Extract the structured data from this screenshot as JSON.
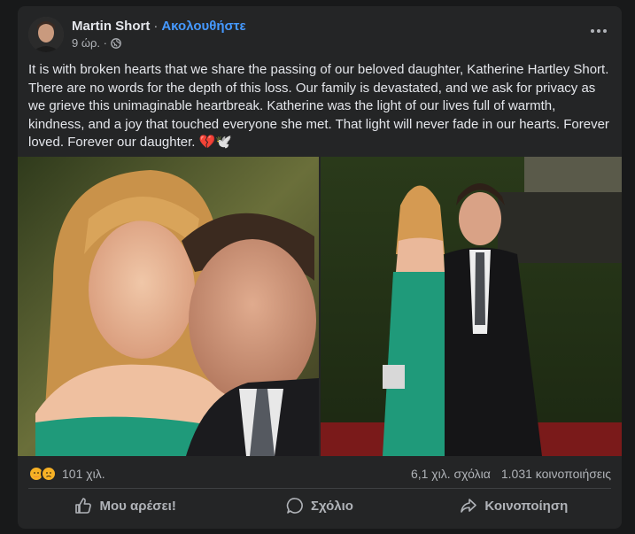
{
  "post": {
    "author": "Martin Short",
    "separator": "·",
    "follow_label": "Ακολουθήστε",
    "time": "9 ώρ. ·",
    "text": "It is with broken hearts that we share the passing of our beloved daughter, Katherine Hartley Short. There are no words for the depth of this loss. Our family is devastated, and we ask for privacy as we grieve this unimaginable heartbreak. Katherine was the light of our lives full of warmth, kindness, and a joy that touched everyone she met. That light will never fade in our hearts. Forever loved. Forever our daughter. 💔🕊️"
  },
  "stats": {
    "reactions_count": "101 χιλ.",
    "comments": "6,1 χιλ. σχόλια",
    "shares": "1.031 κοινοποιήσεις"
  },
  "actions": {
    "like": "Μου αρέσει!",
    "comment": "Σχόλιο",
    "share": "Κοινοποίηση"
  },
  "icons": [
    "globe-icon",
    "more-options-icon",
    "care-reaction-icon",
    "sad-reaction-icon",
    "like-icon",
    "comment-icon",
    "share-icon"
  ],
  "colors": {
    "card": "#242526",
    "link": "#4599ff",
    "text": "#e4e6eb",
    "muted": "#b0b3b8"
  }
}
